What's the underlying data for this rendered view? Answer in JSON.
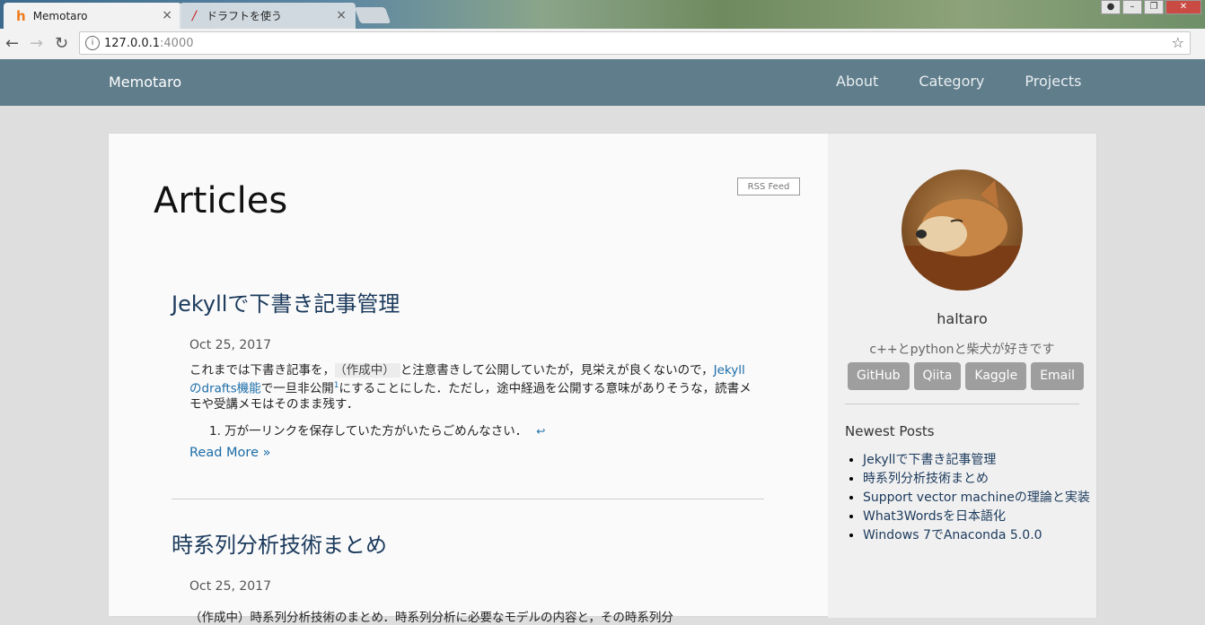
{
  "browser": {
    "tabs": [
      {
        "title": "Memotaro",
        "favicon": "h"
      },
      {
        "title": "ドラフトを使う",
        "favicon": "/"
      }
    ],
    "url_host": "127.0.0.1",
    "url_port": ":4000",
    "info_icon": "i",
    "close_glyph": "×"
  },
  "site": {
    "brand": "Memotaro",
    "nav": [
      "About",
      "Category",
      "Projects"
    ]
  },
  "main": {
    "title": "Articles",
    "rss_label": "RSS Feed",
    "posts": [
      {
        "title": "Jekyllで下書き記事管理",
        "date": "Oct 25, 2017",
        "excerpt_p1": "これまでは下書き記事を，",
        "excerpt_code": "（作成中）",
        "excerpt_p2": "と注意書きして公開していたが，見栄えが良くないので，",
        "excerpt_link": "Jekyllのdrafts機能",
        "excerpt_p3": "で一旦非公開",
        "excerpt_sup": "1",
        "excerpt_p4": "にすることにした．ただし，途中経過を公開する意味がありそうな，読書メモや受講メモはそのまま残す．",
        "footnote": "1. 万が一リンクを保存していた方がいたらごめんなさい．",
        "footnote_return": "↩",
        "read_more": "Read More »"
      },
      {
        "title": "時系列分析技術まとめ",
        "date": "Oct 25, 2017",
        "excerpt_partial": "（作成中）時系列分析技術のまとめ．時系列分析に必要なモデルの内容と，その時系列分"
      }
    ]
  },
  "sidebar": {
    "author": "haltaro",
    "bio": "c++とpythonと柴犬が好きです",
    "social": [
      "GitHub",
      "Qiita",
      "Kaggle",
      "Email"
    ],
    "newest_title": "Newest Posts",
    "newest_posts": [
      "Jekyllで下書き記事管理",
      "時系列分析技術まとめ",
      "Support vector machineの理論と実装",
      "What3Wordsを日本語化",
      "Windows 7でAnaconda 5.0.0"
    ]
  }
}
